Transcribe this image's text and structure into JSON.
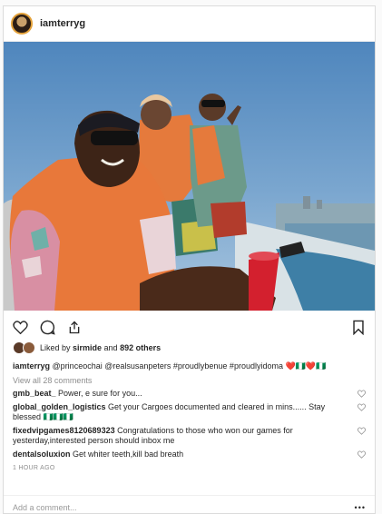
{
  "post": {
    "username": "iamterryg",
    "likes": {
      "prefix": "Liked by ",
      "user": "sirmide",
      "middle": " and ",
      "count": "892 others"
    },
    "caption": {
      "username": "iamterryg",
      "text": "@princeochai @realsusanpeters #proudlybenue #proudlyidoma ❤️🇳🇬❤️🇳🇬"
    },
    "view_all_comments": "View all 28 comments",
    "comments": [
      {
        "user": "gmb_beat_",
        "text": "Power, e sure for you..."
      },
      {
        "user": "global_golden_logistics",
        "text": "Get your Cargoes documented and cleared in mins...... Stay blessed 🇳🇬🇳🇬🇳🇬"
      },
      {
        "user": "fixedvipgames8120689323",
        "text": "Congratulations to those who won our games for yesterday,interested person should inbox me"
      },
      {
        "user": "dentalsoluxion",
        "text": "Get whiter teeth,kill bad breath"
      }
    ],
    "timestamp": "1 HOUR AGO",
    "add_comment_placeholder": "Add a comment...",
    "more_options": "•••"
  },
  "icons": [
    "heart-icon",
    "comment-icon",
    "share-icon",
    "bookmark-icon",
    "comment-like-heart-icon"
  ],
  "colors": {
    "username": "#262626",
    "muted": "#8e8e8e",
    "border": "#dbdbdb",
    "sky": "#5b8fc0",
    "lifejacket": "#e8783a"
  }
}
